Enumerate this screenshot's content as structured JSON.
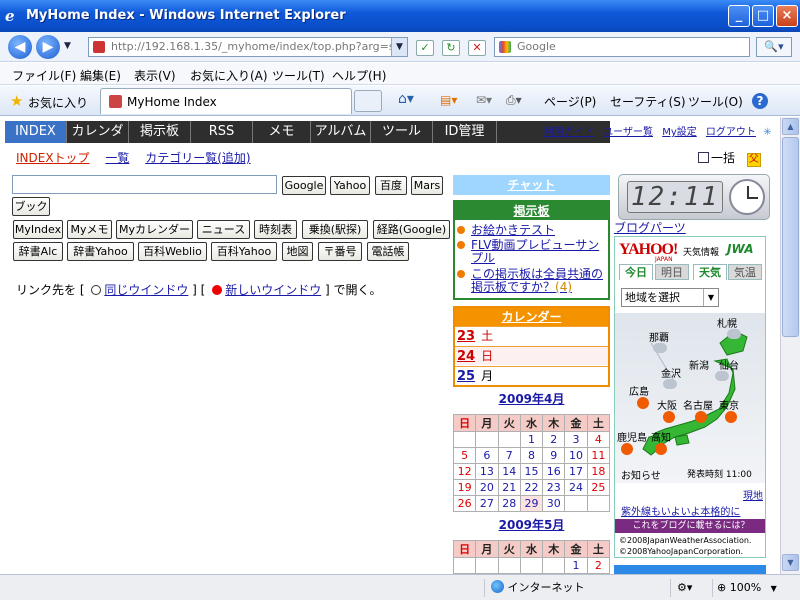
{
  "window": {
    "title": "MyHome Index - Windows Internet Explorer",
    "min": "_",
    "max": "□",
    "close": "×"
  },
  "address": {
    "url": "http://192.168.1.35/_myhome/index/top.php?arg=sessio",
    "search_placeholder": "Google"
  },
  "menu": [
    "ファイル(F)",
    "編集(E)",
    "表示(V)",
    "お気に入り(A)",
    "ツール(T)",
    "ヘルプ(H)"
  ],
  "favorites": {
    "label": "お気に入り",
    "tab_title": "MyHome Index"
  },
  "commands": {
    "page": "ページ(P)",
    "safety": "セーフティ(S)",
    "tools": "ツール(O)"
  },
  "site_nav": {
    "items": [
      "INDEX",
      "カレンダ",
      "掲示板",
      "RSS",
      "メモ",
      "アルバム",
      "ツール",
      "ID管理"
    ],
    "active": "INDEX",
    "top_links": [
      "利用ガイド",
      "ユーザー覧",
      "My設定",
      "ログアウト"
    ]
  },
  "sub_nav": [
    "INDEXトップ",
    "一覧",
    "カテゴリー覧(追加)"
  ],
  "ikkatsu_label": "一括",
  "search_buttons": [
    "Google",
    "Yahoo",
    "百度",
    "Mars",
    "ブック"
  ],
  "link_buttons_row1": [
    "MyIndex",
    "Myメモ",
    "Myカレンダー",
    "ニュース",
    "時刻表",
    "乗換(駅探)",
    "経路(Google)"
  ],
  "link_buttons_row2": [
    "辞書Alc",
    "辞書Yahoo",
    "百科Weblio",
    "百科Yahoo",
    "地図",
    "〒番号",
    "電話帳"
  ],
  "link_target": {
    "prefix": "リンク先を [",
    "same": "同じウインドウ",
    "mid": "] [",
    "new": "新しいウインドウ",
    "suffix": "] で開く。"
  },
  "chat": {
    "title": "チャット"
  },
  "bbs": {
    "title": "掲示板",
    "items": [
      {
        "text": "お絵かきテスト"
      },
      {
        "text": "FLV動画プレビューサンプル"
      },
      {
        "text": "この掲示板は全員共通の掲示板ですか？",
        "count": "(4)"
      }
    ]
  },
  "calendar": {
    "title": "カレンダー",
    "days": [
      {
        "day": "23",
        "weekday": "土"
      },
      {
        "day": "24",
        "weekday": "日"
      },
      {
        "day": "25",
        "weekday": "月"
      }
    ]
  },
  "month_april": {
    "title": "2009年4月",
    "headers": [
      "日",
      "月",
      "火",
      "水",
      "木",
      "金",
      "土"
    ],
    "weeks": [
      [
        "",
        "",
        "",
        "1",
        "2",
        "3",
        "4"
      ],
      [
        "5",
        "6",
        "7",
        "8",
        "9",
        "10",
        "11"
      ],
      [
        "12",
        "13",
        "14",
        "15",
        "16",
        "17",
        "18"
      ],
      [
        "19",
        "20",
        "21",
        "22",
        "23",
        "24",
        "25"
      ],
      [
        "26",
        "27",
        "28",
        "29",
        "30",
        "",
        ""
      ]
    ]
  },
  "month_may": {
    "title": "2009年5月",
    "headers": [
      "日",
      "月",
      "火",
      "水",
      "木",
      "金",
      "土"
    ],
    "weeks": [
      [
        "",
        "",
        "",
        "",
        "",
        "1",
        "2"
      ]
    ]
  },
  "clock": {
    "time": "12:11"
  },
  "blog_parts": "ブログパーツ",
  "weather": {
    "logo": "YAHOO!",
    "logo_sub": "JAPAN",
    "tenki": "天気情報",
    "jwa": "JWA",
    "tabs": [
      "今日",
      "明日",
      "天気",
      "気温"
    ],
    "region_select": "地域を選択",
    "cities": [
      "札幌",
      "那覇",
      "金沢",
      "新潟",
      "仙台",
      "広島",
      "大阪",
      "名古屋",
      "東京",
      "鹿児島",
      "高知"
    ],
    "notice": "お知らせ",
    "issued": "発表時刻 11:00",
    "more": "現地",
    "uv_notice": "紫外線もいよいよ本格的に",
    "blog_banner": "これをブログに載せるには？",
    "copyright1": "©2008JapanWeatherAssociation.",
    "copyright2": "©2008YahooJapanCorporation."
  },
  "status": {
    "zone": "インターネット",
    "zoom": "100%"
  }
}
